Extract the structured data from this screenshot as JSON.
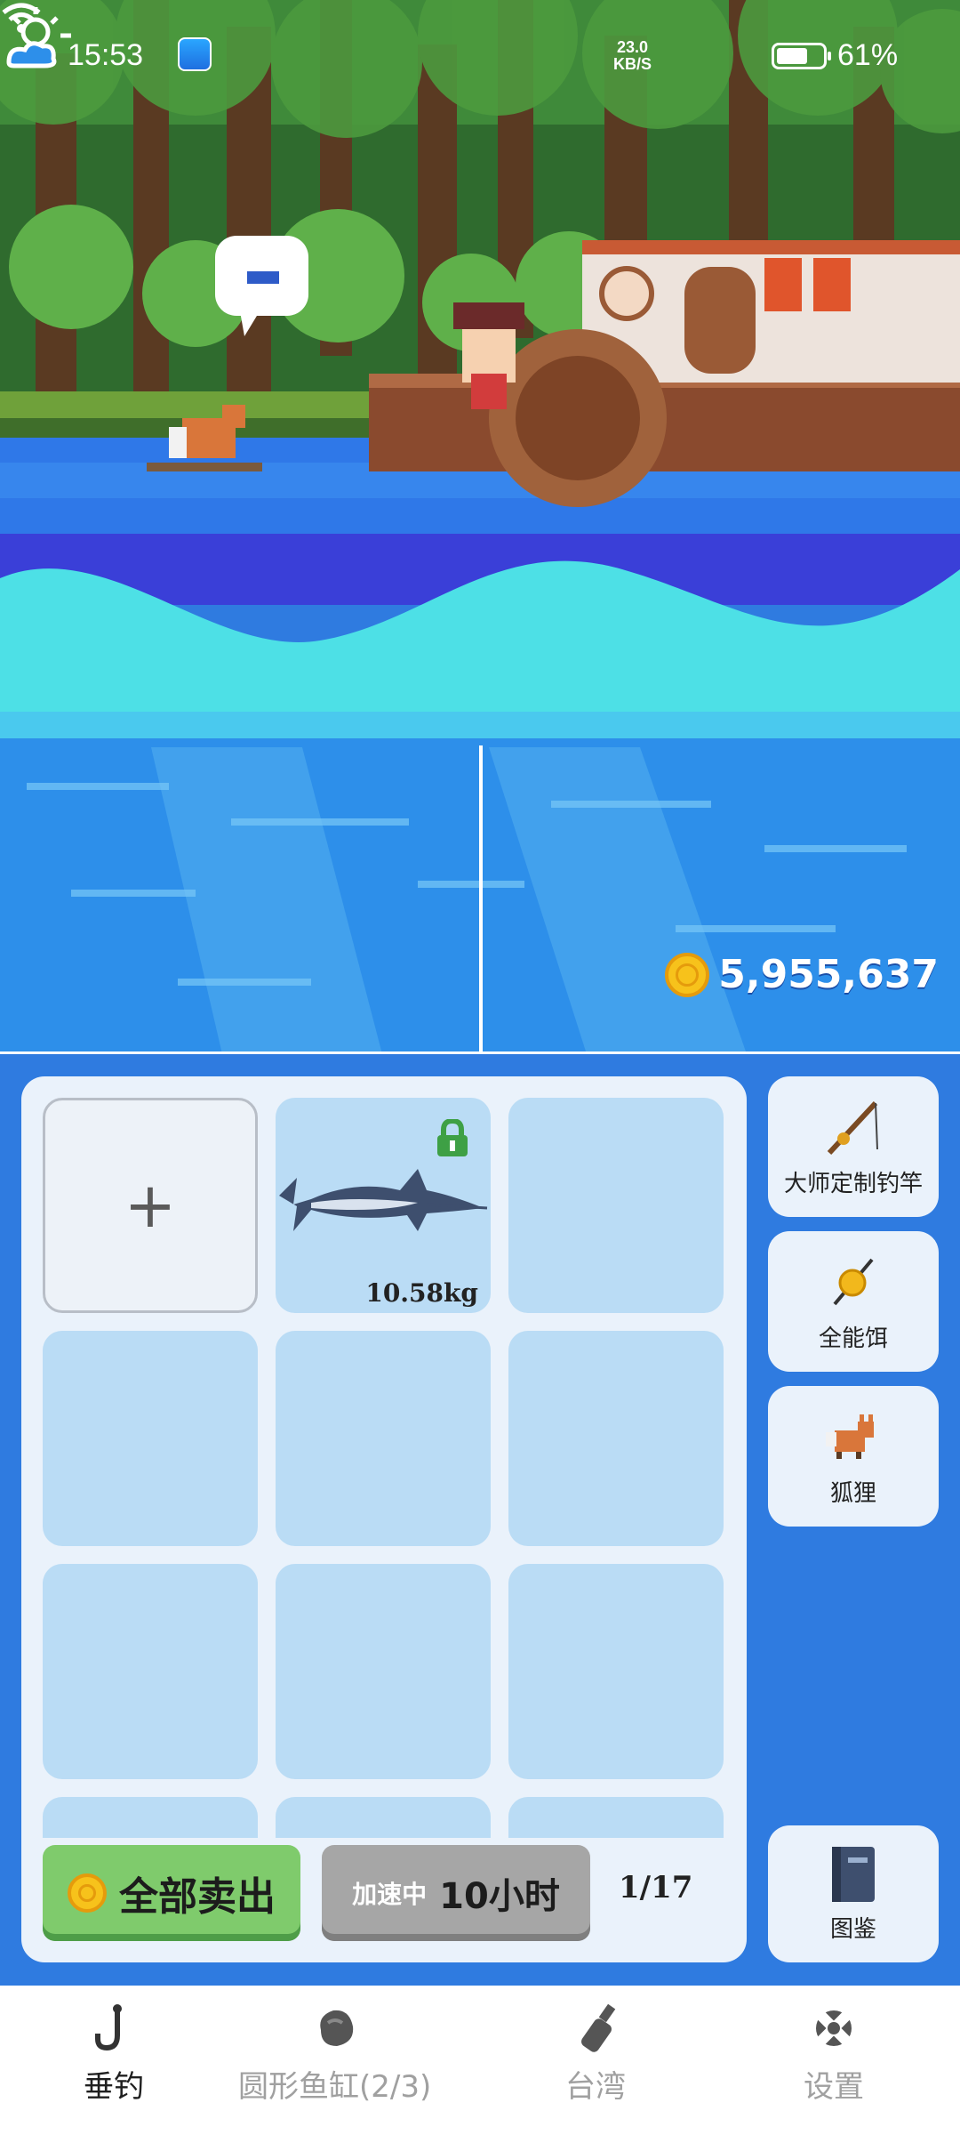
{
  "status_bar": {
    "time": "15:53",
    "net_speed_value": "23.0",
    "net_speed_unit": "KB/S",
    "battery": "61%"
  },
  "scene": {
    "coins": "5,955,637",
    "bubble_icon": "note-bubble-icon",
    "weather_icon": "sun-cloud-icon"
  },
  "inventory": {
    "add_label": "+",
    "slots": [
      {
        "type": "add"
      },
      {
        "type": "fish",
        "fish_icon": "marlin-icon",
        "weight": "10.58kg",
        "locked": true
      },
      {
        "type": "empty"
      },
      {
        "type": "empty"
      },
      {
        "type": "empty"
      },
      {
        "type": "empty"
      },
      {
        "type": "empty"
      },
      {
        "type": "empty"
      },
      {
        "type": "empty"
      }
    ],
    "sell_all_label": "全部卖出",
    "speedup_label": "加速中",
    "speedup_time": "10小时",
    "page_count": "1/17"
  },
  "equipment": [
    {
      "icon": "fishing-rod-icon",
      "label": "大师定制钓竿"
    },
    {
      "icon": "bait-icon",
      "label": "全能饵"
    },
    {
      "icon": "fox-icon",
      "label": "狐狸"
    }
  ],
  "codex": {
    "icon": "book-icon",
    "label": "图鉴"
  },
  "nav": {
    "items": [
      {
        "label": "垂钓",
        "icon": "fishing-hook-icon",
        "active": true
      },
      {
        "label": "圆形鱼缸(2/3)",
        "icon": "stone-icon",
        "active": false
      },
      {
        "label": "台湾",
        "icon": "bottle-icon",
        "active": false
      },
      {
        "label": "设置",
        "icon": "settings-icon",
        "active": false
      }
    ]
  },
  "colors": {
    "sky_forest": "#3E7A34",
    "water_deep": "#2E5BE0",
    "wave_light": "#4DE0E6",
    "panel_bg": "#EAF2FB",
    "slot_bg": "#BADCF5",
    "sell_green": "#7FCB6C",
    "speed_gray": "#A6A6A6"
  }
}
